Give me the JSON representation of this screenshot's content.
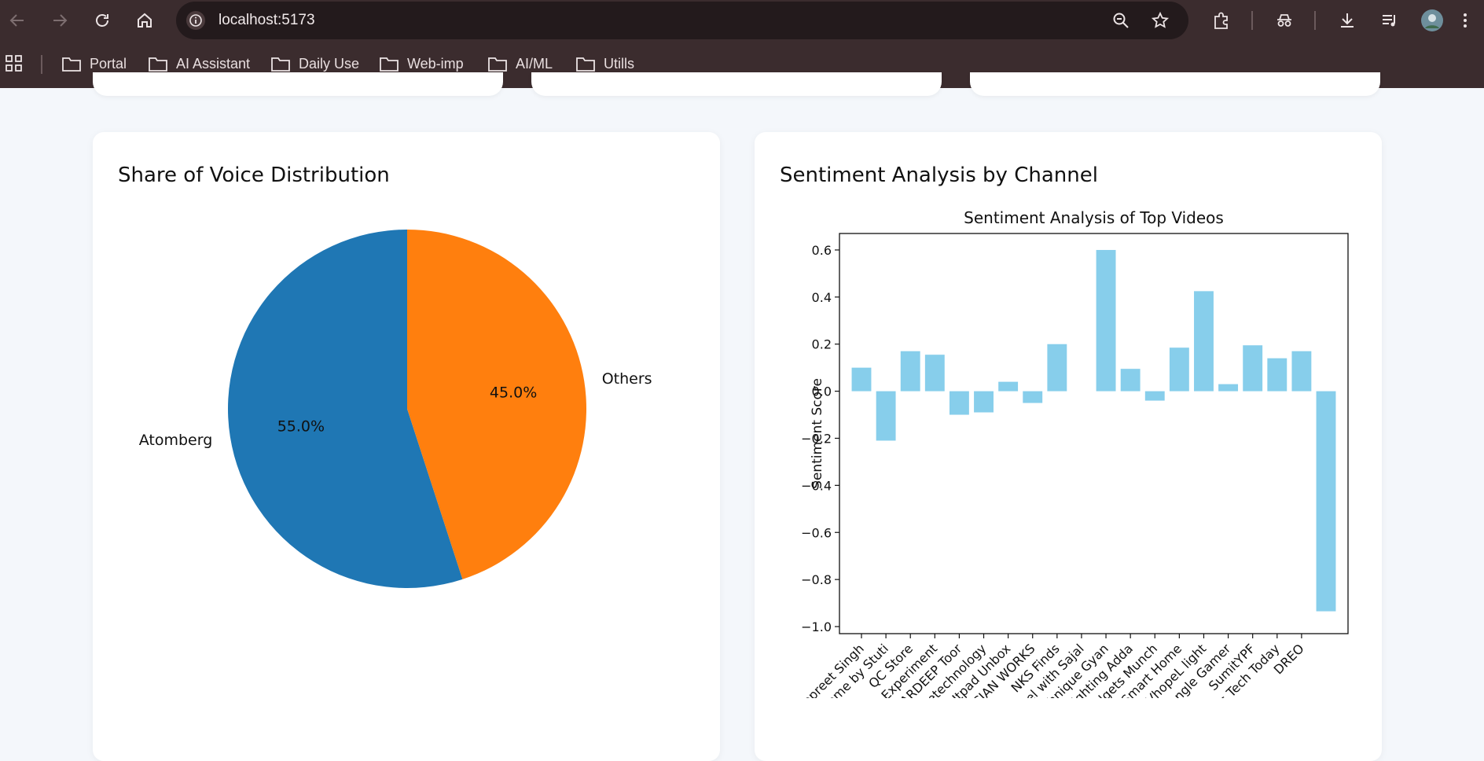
{
  "browser": {
    "url": "localhost:5173",
    "bookmarks": [
      {
        "label": "Portal"
      },
      {
        "label": "AI Assistant"
      },
      {
        "label": "Daily Use"
      },
      {
        "label": "Web-imp"
      },
      {
        "label": "AI/ML"
      },
      {
        "label": "Utills"
      }
    ]
  },
  "cards": {
    "share_title": "Share of Voice Distribution",
    "sentiment_title": "Sentiment Analysis by Channel"
  },
  "colors": {
    "chrome_bg": "#3b2c2e",
    "pie_blue": "#1f77b4",
    "pie_orange": "#ff7f0e",
    "bar": "#87ceeb"
  },
  "chart_data": [
    {
      "type": "pie",
      "labels": [
        "Atomberg",
        "Others"
      ],
      "values": [
        55.0,
        45.0
      ],
      "value_labels": [
        "55.0%",
        "45.0%"
      ],
      "start_angle_deg": 90,
      "colors": [
        "#1f77b4",
        "#ff7f0e"
      ]
    },
    {
      "type": "bar",
      "title": "Sentiment Analysis of Top Videos",
      "ylabel": "Sentiment Score",
      "categories": [
        "Lovepreet Singh",
        "Quirk Art for Home by Stuti",
        "QC Store",
        "AJAY light Experiment",
        "AMARDEEP Toor",
        "Gfuturetechnology",
        "Utpad Unbox",
        "SHIVA ELECTRICIAN WORKS",
        "NKS Finds",
        "Travel with Sajal",
        "Amazing Technique Gyan",
        "Lighting Adda",
        "Gadgets Munch",
        "Smart Home",
        "VhopeL light",
        "Triangle Gamer",
        "SumitYPF",
        "This is Tech Today",
        "DREO"
      ],
      "values": [
        0.1,
        -0.21,
        0.17,
        0.155,
        -0.1,
        -0.09,
        0.04,
        -0.05,
        0.2,
        0.0,
        0.6,
        0.095,
        -0.04,
        0.185,
        0.425,
        0.03,
        0.195,
        0.14,
        0.17,
        -0.935
      ],
      "ylim": [
        -1.03,
        0.67
      ],
      "yticks": [
        0.6,
        0.4,
        0.2,
        0.0,
        -0.2,
        -0.4,
        -0.6,
        -0.8,
        -1.0
      ],
      "ytick_labels": [
        "0.6",
        "0.4",
        "0.2",
        "0.0",
        "−0.2",
        "−0.4",
        "−0.6",
        "−0.8",
        "−1.0"
      ]
    }
  ]
}
